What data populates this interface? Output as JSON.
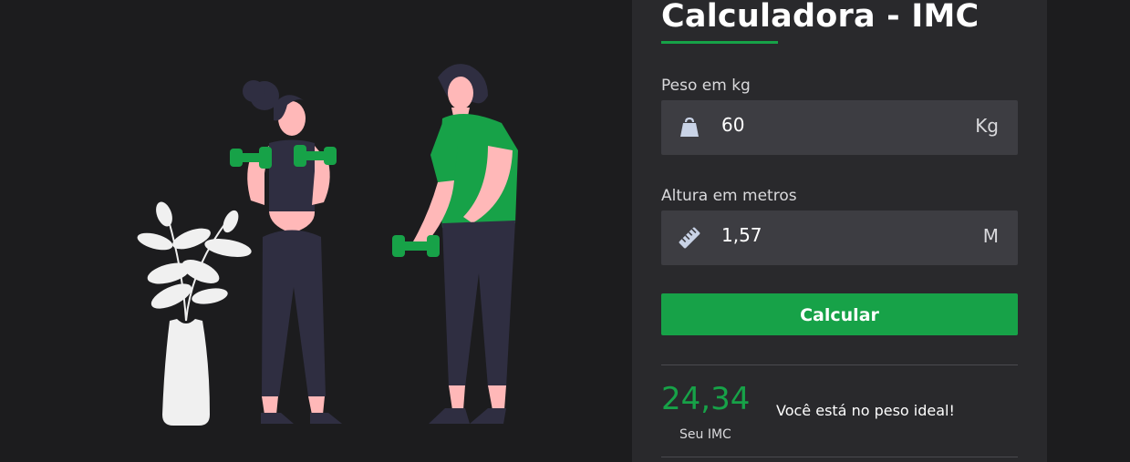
{
  "form": {
    "title": "Calculadora - IMC",
    "weight": {
      "label": "Peso em kg",
      "value": "60",
      "unit": "Kg",
      "icon": "weight-icon"
    },
    "height": {
      "label": "Altura em metros",
      "value": "1,57",
      "unit": "M",
      "icon": "ruler-icon"
    },
    "submit_label": "Calcular"
  },
  "result": {
    "value": "24,34",
    "label": "Seu IMC",
    "message": "Você está no peso ideal!"
  },
  "colors": {
    "accent": "#17a248",
    "panel": "#29292c",
    "background": "#1c1c1e",
    "field": "#3d3d42"
  }
}
